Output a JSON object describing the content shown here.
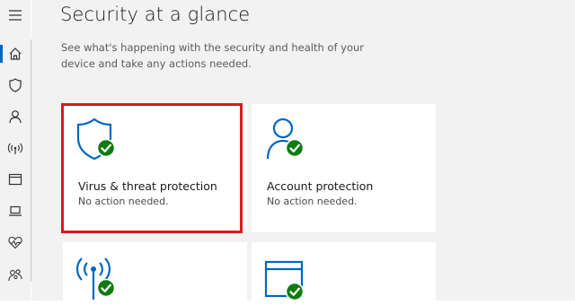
{
  "main": {
    "title": "Security at a glance",
    "description": "See what's happening with the security and health of your device and take any actions needed."
  },
  "sidebar": {
    "items": [
      {
        "icon": "hamburger-menu-icon"
      },
      {
        "icon": "home-icon",
        "active": true
      },
      {
        "icon": "shield-icon"
      },
      {
        "icon": "person-icon"
      },
      {
        "icon": "wireless-icon"
      },
      {
        "icon": "app-browser-icon"
      },
      {
        "icon": "laptop-icon"
      },
      {
        "icon": "heart-pulse-icon"
      },
      {
        "icon": "family-icon"
      }
    ]
  },
  "cards": [
    {
      "title": "Virus & threat protection",
      "status": "No action needed.",
      "icon": "shield-icon",
      "highlighted": true
    },
    {
      "title": "Account protection",
      "status": "No action needed.",
      "icon": "person-icon"
    },
    {
      "title": "",
      "status": "",
      "icon": "wireless-icon"
    },
    {
      "title": "",
      "status": "",
      "icon": "app-browser-icon"
    }
  ],
  "colors": {
    "accent": "#0067c0",
    "ok": "#0f7b0f",
    "highlight": "#e3141b",
    "background": "#f2f2f2"
  }
}
